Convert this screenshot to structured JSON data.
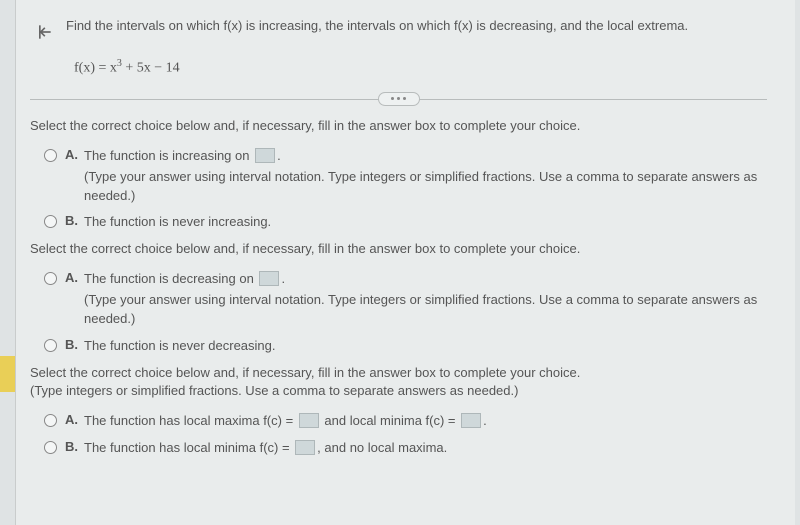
{
  "question": {
    "prompt": "Find the intervals on which f(x) is increasing, the intervals on which f(x) is decreasing, and the local extrema.",
    "formula_html": "f(x) = x<sup>3</sup> + 5x − 14"
  },
  "blocks": [
    {
      "instruction": "Select the correct choice below and, if necessary, fill in the answer box to complete your choice.",
      "options": [
        {
          "letter": "A.",
          "text_before": "The function is increasing on ",
          "has_blank": true,
          "text_after": ".",
          "hint": "(Type your answer using interval notation. Type integers or simplified fractions. Use a comma to separate answers as needed.)"
        },
        {
          "letter": "B.",
          "text_before": "The function is never increasing.",
          "has_blank": false,
          "text_after": "",
          "hint": ""
        }
      ]
    },
    {
      "instruction": "Select the correct choice below and, if necessary, fill in the answer box to complete your choice.",
      "options": [
        {
          "letter": "A.",
          "text_before": "The function is decreasing on ",
          "has_blank": true,
          "text_after": ".",
          "hint": "(Type your answer using interval notation. Type integers or simplified fractions. Use a comma to separate answers as needed.)"
        },
        {
          "letter": "B.",
          "text_before": "The function is never decreasing.",
          "has_blank": false,
          "text_after": "",
          "hint": ""
        }
      ]
    },
    {
      "instruction": "Select the correct choice below and, if necessary, fill in the answer box to complete your choice.\n(Type integers or simplified fractions. Use a comma to separate answers as needed.)",
      "options": [
        {
          "letter": "A.",
          "text_before": "The function has local maxima f(c) = ",
          "has_blank": true,
          "text_after": " and local minima f(c) = ",
          "has_blank2": true,
          "text_after2": ".",
          "hint": ""
        },
        {
          "letter": "B.",
          "text_before": "The function has local minima f(c) = ",
          "has_blank": true,
          "text_after": ", and no local maxima.",
          "hint": ""
        }
      ]
    }
  ]
}
